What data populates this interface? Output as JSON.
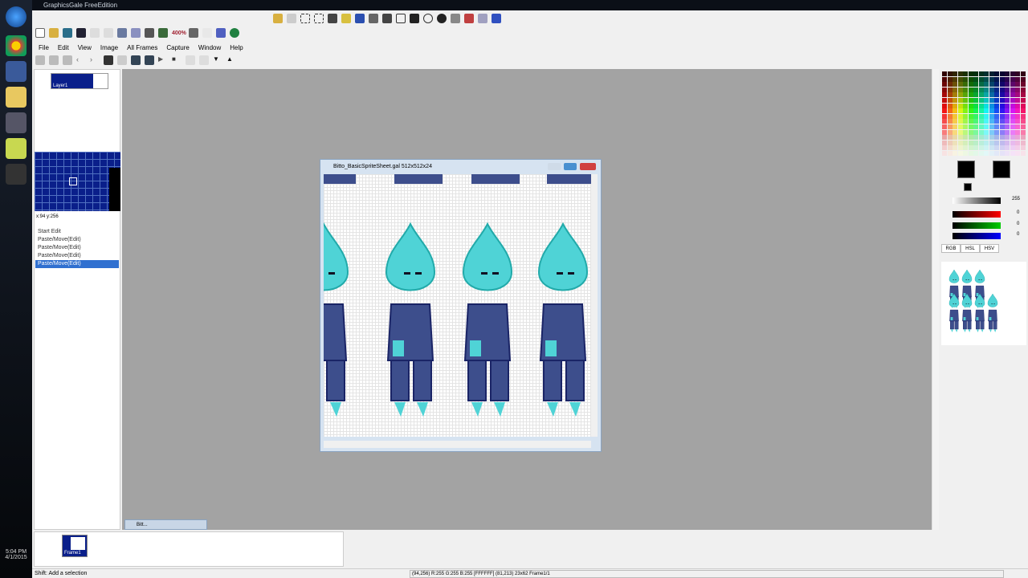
{
  "app": {
    "title": "GraphicsGale FreeEdition"
  },
  "menu": [
    "File",
    "Edit",
    "View",
    "Image",
    "All Frames",
    "Capture",
    "Window",
    "Help"
  ],
  "toolbar": {
    "zoom_value": "400%"
  },
  "layers": {
    "layer_name": "Layer1"
  },
  "navigator": {
    "coords": "x:94 y:256"
  },
  "history": [
    "Start Edit",
    "Paste/Move(Edit)",
    "Paste/Move(Edit)",
    "Paste/Move(Edit)",
    "Paste/Move(Edit)"
  ],
  "history_selected": 4,
  "image_window": {
    "title": "Bitto_BasicSpriteSheet.gal 512x512x24"
  },
  "minimized_window": {
    "title": "Bitt..."
  },
  "frames": {
    "frame_name": "Frame1"
  },
  "color_panel": {
    "alpha_value": "255",
    "r": "0",
    "g": "0",
    "b": "0",
    "tabs": [
      "RGB",
      "HSL",
      "HSV"
    ]
  },
  "status": {
    "hint": "Shift: Add a selection",
    "info": "(94,256) R:255 G:255 B:255 [FFFFFF] (81,213) 23x62 Frame1/1"
  },
  "clock": {
    "time": "5:04 PM",
    "date": "4/1/2015"
  },
  "colors": {
    "head": "#4fd3d6",
    "body": "#3d4e8c",
    "outline": "#1a2466",
    "workspace": "#a3a3a3"
  }
}
